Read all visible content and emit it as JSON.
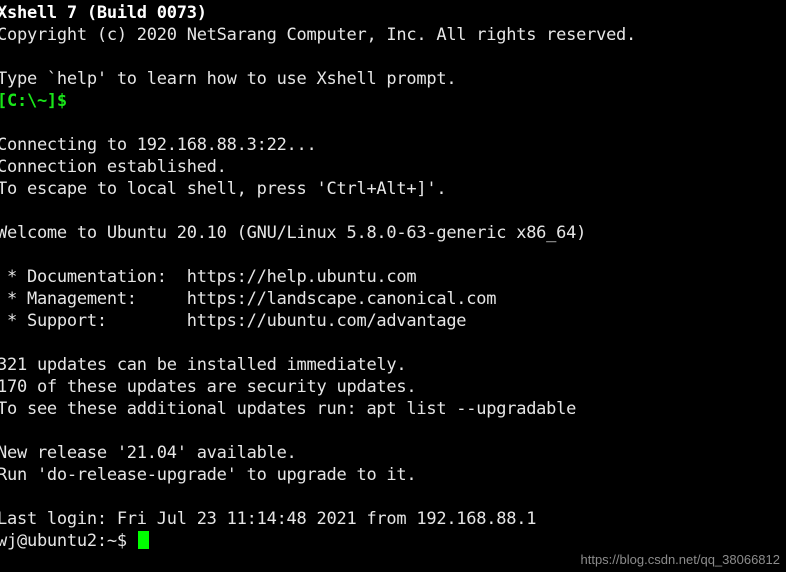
{
  "terminal": {
    "background_color": "#000000",
    "foreground_color": "#e6e6e6",
    "prompt_color": "#19e619",
    "cursor_color": "#00ff00",
    "lines": [
      {
        "text": "Xshell 7 (Build 0073)",
        "style": "bold"
      },
      {
        "text": "Copyright (c) 2020 NetSarang Computer, Inc. All rights reserved.",
        "style": "normal"
      },
      {
        "text": "",
        "style": "blank"
      },
      {
        "text": "Type `help' to learn how to use Xshell prompt.",
        "style": "normal"
      },
      {
        "text": "[C:\\~]$",
        "style": "green"
      },
      {
        "text": "",
        "style": "blank"
      },
      {
        "text": "Connecting to 192.168.88.3:22...",
        "style": "normal"
      },
      {
        "text": "Connection established.",
        "style": "normal"
      },
      {
        "text": "To escape to local shell, press 'Ctrl+Alt+]'.",
        "style": "normal"
      },
      {
        "text": "",
        "style": "blank"
      },
      {
        "text": "Welcome to Ubuntu 20.10 (GNU/Linux 5.8.0-63-generic x86_64)",
        "style": "normal"
      },
      {
        "text": "",
        "style": "blank"
      },
      {
        "text": " * Documentation:  https://help.ubuntu.com",
        "style": "normal"
      },
      {
        "text": " * Management:     https://landscape.canonical.com",
        "style": "normal"
      },
      {
        "text": " * Support:        https://ubuntu.com/advantage",
        "style": "normal"
      },
      {
        "text": "",
        "style": "blank"
      },
      {
        "text": "321 updates can be installed immediately.",
        "style": "normal"
      },
      {
        "text": "170 of these updates are security updates.",
        "style": "normal"
      },
      {
        "text": "To see these additional updates run: apt list --upgradable",
        "style": "normal"
      },
      {
        "text": "",
        "style": "blank"
      },
      {
        "text": "New release '21.04' available.",
        "style": "normal"
      },
      {
        "text": "Run 'do-release-upgrade' to upgrade to it.",
        "style": "normal"
      },
      {
        "text": "",
        "style": "blank"
      },
      {
        "text": "Last login: Fri Jul 23 11:14:48 2021 from 192.168.88.1",
        "style": "normal"
      }
    ],
    "prompt": {
      "text": "wj@ubuntu2:~$ ",
      "cursor": "block-cursor"
    }
  },
  "watermark": {
    "text": "https://blog.csdn.net/qq_38066812"
  }
}
